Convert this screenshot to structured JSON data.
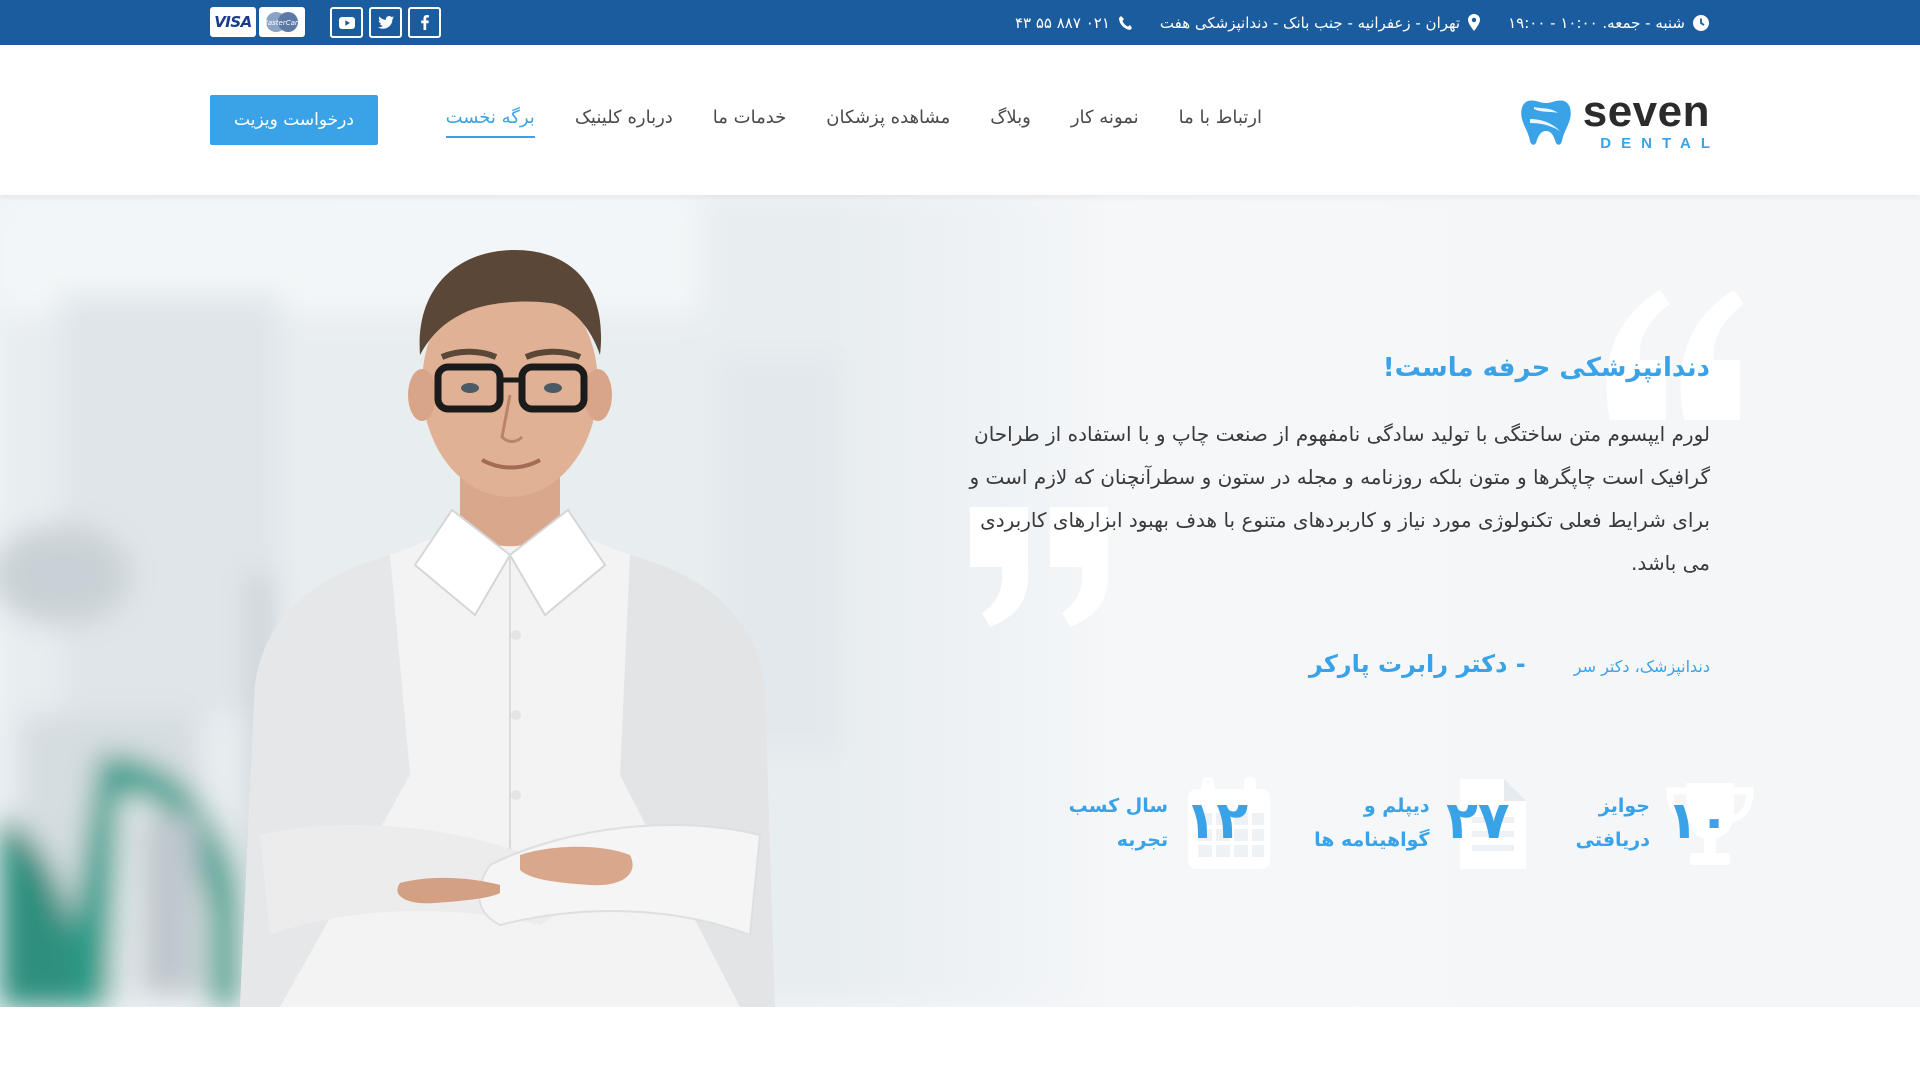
{
  "topbar": {
    "phone": "۰۲۱ ۸۸۷ ۵۵ ۴۳",
    "address": "تهران - زعفرانیه - جنب بانک - دندانپزشکی هفت",
    "hours": "شنبه - جمعه. ۱۰:۰۰ - ۱۹:۰۰",
    "social": [
      "facebook-icon",
      "twitter-icon",
      "youtube-icon"
    ],
    "payments": [
      "VISA",
      "MasterCard"
    ]
  },
  "header": {
    "logo": {
      "word": "seven",
      "sub": "DENTAL"
    },
    "nav": [
      {
        "label": "برگه نخست",
        "active": true
      },
      {
        "label": "درباره کلینیک"
      },
      {
        "label": "خدمات ما"
      },
      {
        "label": "مشاهده پزشکان"
      },
      {
        "label": "وبلاگ"
      },
      {
        "label": "نمونه کار"
      },
      {
        "label": "ارتباط با ما"
      }
    ],
    "cta": "درخواست ویزیت"
  },
  "hero": {
    "headline": "دندانپزشکی حرفه ماست!",
    "body": "لورم ایپسوم متن ساختگی با تولید سادگی نامفهوم از صنعت چاپ و با استفاده از طراحان گرافیک است چاپگرها و متون بلکه روزنامه و مجله در ستون و سطرآنچنان که لازم است و برای شرایط فعلی تکنولوژی مورد نیاز و کاربردهای متنوع با هدف بهبود ابزارهای کاربردی می باشد.",
    "author_name": "- دکتر رابرت پارکر",
    "author_role": "دندانپزشک، دکتر سر",
    "stats": [
      {
        "number": "۱۲",
        "label": "سال کسب\nتجربه",
        "icon": "calendar-icon"
      },
      {
        "number": "۲۷",
        "label": "دیپلم و\nگواهینامه ها",
        "icon": "document-icon"
      },
      {
        "number": "۱۰",
        "label": "جوایز\nدریافتی",
        "icon": "trophy-icon"
      }
    ]
  },
  "colors": {
    "topbar": "#1b5c9e",
    "accent": "#3aa3e8",
    "text": "#3a3a3a"
  }
}
